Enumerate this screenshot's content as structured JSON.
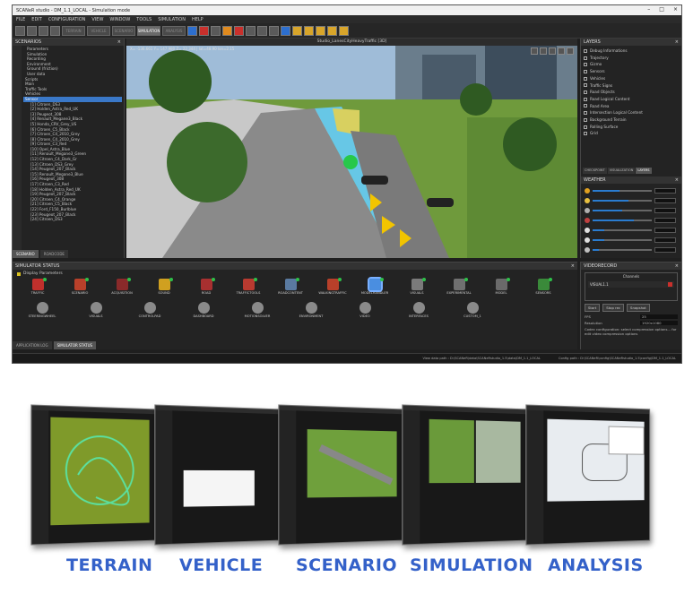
{
  "app": {
    "title": "SCANeR studio - DM_1.1_LOCAL - Simulation mode",
    "menu": [
      "FILE",
      "EDIT",
      "CONFIGURATION",
      "VIEW",
      "WINDOW",
      "TOOLS",
      "SIMULATION",
      "HELP"
    ],
    "toolbar_buttons": [
      "TERRAIN",
      "VEHICLE",
      "SCENARIO",
      "SIMULATION",
      "ANALYSIS"
    ]
  },
  "scenarios_panel": {
    "title": "SCENARIOS",
    "items": [
      "Parameters",
      "Simulation",
      "Recording",
      "Environment",
      "Ground (friction)",
      "User data",
      "Scripts",
      "Main",
      "Traffic Tools",
      "Vehicles",
      "Sensor",
      "[1] Citroen_DS3",
      "[2] Holden_Astra_Red_UK",
      "[3] Peugeot_308",
      "[4] Renault_Megane3_Black",
      "[5] Honda_CRV_Grey_US",
      "[6] Citroen_C5_Black",
      "[7] Citroen_C4_2010_Grey",
      "[8] Citroen_C4_2010_Grey",
      "[9] Citroen_C3_Red",
      "[10] Opel_Astra_Blue",
      "[11] Renault_Megane3_Green",
      "[12] Citroen_C4_Dark_Gr",
      "[13] Citroen_DS3_Grey",
      "[14] Peugeot_207_Black",
      "[15] Renault_Megane3_Blue",
      "[16] Peugeot_308",
      "[17] Citroen_C3_Red",
      "[18] Holden_Astra_Red_UK",
      "[19] Peugeot_207_Black",
      "[20] Citroen_C4_Orange",
      "[21] Citroen_C5_Black",
      "[22] Ford_F150_Burlblue",
      "[23] Peugeot_207_Black",
      "[24] Citroen_DS3"
    ],
    "selected_index": 10,
    "tabs": [
      "SCENARIO",
      "ROADCODE"
    ]
  },
  "viewport": {
    "title": "Studio_LanesCityHeavyTraffic [3D]",
    "coords": "X= -136.661  Y= 147.980  Z= 22.344 | lat=48.90  lon=2.15"
  },
  "layers_panel": {
    "title": "LAYERS",
    "items": [
      "Debug Informations",
      "Trajectory",
      "Gizmo",
      "Sensors",
      "Vehicles",
      "Traffic Signs",
      "Road Objects",
      "Road Logical Content",
      "Road Area",
      "Intersection Logical Content",
      "Background Terrain",
      "Rolling Surface",
      "Grid"
    ],
    "tabs": [
      "CHECKPOINT",
      "VISUALIZATION",
      "LAYERS"
    ]
  },
  "weather_panel": {
    "title": "WEATHER",
    "levels": [
      0.45,
      0.6,
      0.5,
      0.7,
      0.2,
      0.2,
      0.1
    ]
  },
  "sim_status": {
    "title": "SIMULATOR STATUS",
    "display_label": "Display Parameters",
    "modules_row1": [
      "TRAFFIC",
      "SCENARIO",
      "ACQUISITION",
      "SOUND",
      "ROAD",
      "TRAFFICTOOLS",
      "ROADCONTENT",
      "WALKINGTRAFFIC",
      "MODELHANDLER",
      "VISUALS",
      "EXPERIMENTAL",
      "MODEL",
      "SENSORS"
    ],
    "modules_row2": [
      "STEERINGWHEEL",
      "VISUALS",
      "CONTROLPAD",
      "DASHBOARD",
      "MOTIONSOLVER",
      "ENVIRONMENT",
      "VIDEO",
      "INTERFACES",
      "CUSTOM_1"
    ],
    "highlighted_module": 8,
    "tabs": [
      "APPLICATION LOG",
      "SIMULATOR STATUS"
    ]
  },
  "video_panel": {
    "title": "VIDEORECORD",
    "channels_label": "Channels",
    "channel": "VISUAL1.1",
    "buttons": [
      "Start",
      "Stop rec",
      "Snapshot"
    ],
    "fields": [
      [
        "FPS",
        "25"
      ],
      [
        "Resolution",
        "1920x1080"
      ]
    ],
    "note": "Codec configuration: select compression options... for edit video compression options"
  },
  "status_bar": {
    "view_path": "View data path : D:\\SCANeR\\data\\SCANeRstudio_1.5\\data\\DM_1.1_LOCAL",
    "config_path": "Config path : D:\\SCANeR\\config\\SCANeRstudio_1.5\\config\\DM_1.1_LOCAL"
  },
  "workflow": {
    "labels": [
      "TERRAIN",
      "VEHICLE",
      "SCENARIO",
      "SIMULATION",
      "ANALYSIS"
    ]
  }
}
